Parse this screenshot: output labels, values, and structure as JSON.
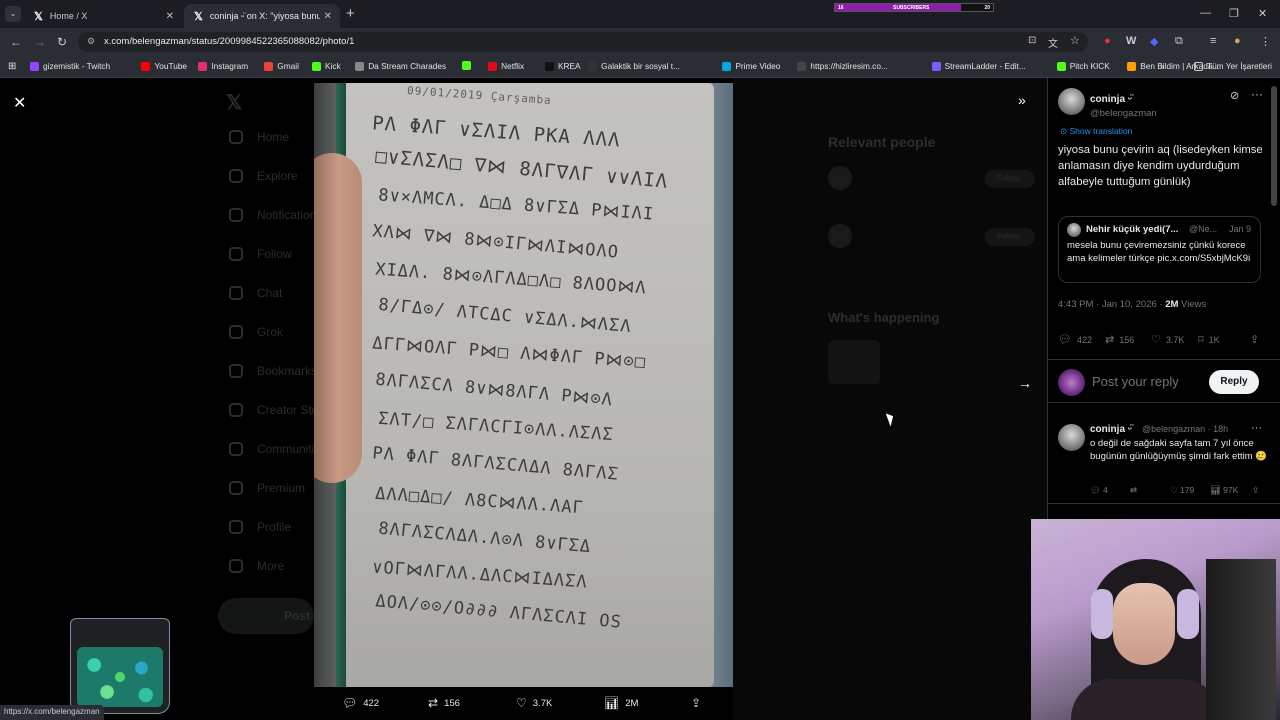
{
  "browser": {
    "tabs": [
      {
        "label": "Home / X",
        "active": false
      },
      {
        "label": "coninja ᵕ̈ on X: \"yiyosa bunu ç",
        "active": true
      }
    ],
    "url": "x.com/belengazman/status/2009984522365088082/photo/1",
    "subscriber_goal": {
      "current": "16",
      "label": "SUBSCRIBERS",
      "target": "20",
      "progress": 0.8
    },
    "bookmarks": [
      {
        "label": "gizemistik - Twitch",
        "icon": "twitch-icon",
        "color": "#9146ff"
      },
      {
        "label": "YouTube",
        "icon": "youtube-icon",
        "color": "#ff0000"
      },
      {
        "label": "Instagram",
        "icon": "instagram-icon",
        "color": "#e1306c"
      },
      {
        "label": "Gmail",
        "icon": "gmail-icon",
        "color": "#ea4335"
      },
      {
        "label": "Kick",
        "icon": "kick-icon",
        "color": "#53fc18"
      },
      {
        "label": "Da Stream Charades",
        "icon": "mask-icon",
        "color": "#888888"
      },
      {
        "label": "",
        "icon": "kick-icon",
        "color": "#53fc18"
      },
      {
        "label": "Netflix",
        "icon": "netflix-icon",
        "color": "#e50914"
      },
      {
        "label": "KREA",
        "icon": "krea-icon",
        "color": "#111111"
      },
      {
        "label": "Galaktik bir sosyal t...",
        "icon": "zk-icon",
        "color": "#333333"
      },
      {
        "label": "Prime Video",
        "icon": "prime-icon",
        "color": "#00a8e1"
      },
      {
        "label": "https://hizliresim.co...",
        "icon": "h-icon",
        "color": "#444444"
      },
      {
        "label": "StreamLadder - Edit...",
        "icon": "sl-icon",
        "color": "#7b5cff"
      },
      {
        "label": "Pitch KICK",
        "icon": "kick-icon",
        "color": "#53fc18"
      },
      {
        "label": "Ben Bildim | Arkada...",
        "icon": "lightbulb-icon",
        "color": "#ffa000"
      }
    ],
    "all_bookmarks": "Tüm Yer İşaretleri",
    "status_url": "https://x.com/belengazman"
  },
  "background": {
    "nav": [
      "Home",
      "Explore",
      "Notifications",
      "Follow",
      "Chat",
      "Grok",
      "Bookmarks",
      "Creator Studio",
      "Communities",
      "Premium",
      "Profile",
      "More"
    ],
    "post_button": "Post",
    "relevant_people": "Relevant people",
    "whats_happening": "What's happening",
    "follow": "Follow"
  },
  "photo": {
    "handwriting": {
      "date": "09/01/2019 Çarşamba",
      "lines": [
        "ΡΛ ΦΛΓ ∨ΣΛΙΛ ΡΚΑ ΛΛΛ",
        "□∨ΣΛΣΛ□ ∇⋈ 8ΛΓ∇ΛΓ ∨∨ΛΙΛ",
        "8∨×ΛΜCΛ. Δ□Δ 8∨ΓΣΔ Ρ⋈ΙΛΙ",
        "ΧΛ⋈ ∇⋈ 8⋈⊙ΙΓ⋈ΛΙ⋈ΟΛΟ",
        "ΧΙΔΛ. 8⋈⊙ΛΓΛΔ□Λ□ 8ΛΟΟ⋈Λ",
        "8/ΓΔ⊙/ ΛΤCΔC ∨ΣΔΛ.⋈ΛΣΛ",
        "ΔΓΓ⋈ΟΛΓ Ρ⋈□ Λ⋈ΦΛΓ Ρ⋈⊙□",
        "8ΛΓΛΣCΛ 8∨⋈8ΛΓΛ Ρ⋈⊙Λ",
        "ΣΛΤ/□ ΣΛΓΛCΓΙ⊙ΛΛ.ΛΣΛΣ",
        "ΡΛ ΦΛΓ 8ΛΓΛΣCΛΔΛ 8ΛΓΛΣ",
        "ΔΛΛ□Δ□/ Λ8C⋈ΛΛ.ΛΑΓ",
        "8ΛΓΛΣCΛΔΛ.Λ⊙Λ 8∨ΓΣΔ",
        "∨ΟΓ⋈ΛΓΛΛ.ΔΛC⋈ΙΔΛΣΛ",
        "ΔΟΛ/⊙⊙/Ο∂∂∂ ΛΓΛΣCΛΙ ΟS"
      ]
    },
    "stats": {
      "replies": "422",
      "reposts": "156",
      "likes": "3.7K",
      "views": "2M"
    }
  },
  "tweet": {
    "author_name": "coninja ᵕ̈",
    "author_handle": "@belengazman",
    "show_translation": "Show translation",
    "text": "yiyosa bunu çevirin aq (lisedeyken kimse anlamasın diye kendim uydurduğum alfabeyle tuttuğum günlük)",
    "quote": {
      "name": "Nehir küçük yedi(7...",
      "handle": "@Ne...",
      "date": "Jan 9",
      "text": "mesela bunu çeviremezsiniz çünkü korece ama kelimeler türkçe pic.x.com/S5xbjMcK9i"
    },
    "time": "4:43 PM · Jan 10, 2026 · ",
    "views_count": "2M",
    "views_label": " Views",
    "actions": {
      "replies": "422",
      "reposts": "156",
      "likes": "3.7K",
      "bookmarks": "1K"
    },
    "reply_placeholder": "Post your reply",
    "reply_button": "Reply"
  },
  "reply": {
    "name": "coninja ᵕ̈",
    "handle": "@belengazman · 18h",
    "text": "o değil de sağdaki sayfa tam 7 yıl önce bugünün günlüğüymüş şimdi fark ettim 🥲",
    "stats": {
      "replies": "4",
      "reposts": "",
      "likes": "179",
      "views": "97K"
    }
  }
}
